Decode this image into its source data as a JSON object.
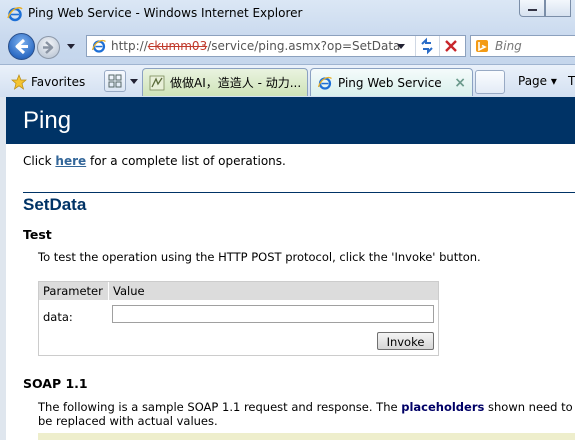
{
  "window": {
    "title": "Ping Web Service - Windows Internet Explorer"
  },
  "navigation": {
    "address_prefix": "http://",
    "address_redacted": "ckumm03",
    "address_suffix": "/service/ping.asmx?op=SetData",
    "search_placeholder": "Bing"
  },
  "tabs_bar": {
    "favorites_label": "Favorites",
    "tabs": [
      {
        "label": "做做AI，造造人 - 动力...",
        "active": false
      },
      {
        "label": "Ping Web Service",
        "active": true
      }
    ],
    "page_menu_label": "Page ▾",
    "tools_menu_label": "T"
  },
  "page": {
    "heading": "Ping",
    "intro_before": "Click ",
    "intro_link": "here",
    "intro_after": " for a complete list of operations.",
    "operation_title": "SetData",
    "test_title": "Test",
    "test_description": "To test the operation using the HTTP POST protocol, click the 'Invoke' button.",
    "table": {
      "col_parameter": "Parameter",
      "col_value": "Value",
      "param_name": "data:",
      "param_value": ""
    },
    "invoke_label": "Invoke",
    "soap_title": "SOAP 1.1",
    "soap_desc_before": "The following is a sample SOAP 1.1 request and response. The ",
    "soap_desc_bold": "placeholders",
    "soap_desc_after": " shown need to be replaced with actual values."
  },
  "colors": {
    "heading_band": "#003366",
    "link": "#336699",
    "code_background": "#eeeecc"
  }
}
